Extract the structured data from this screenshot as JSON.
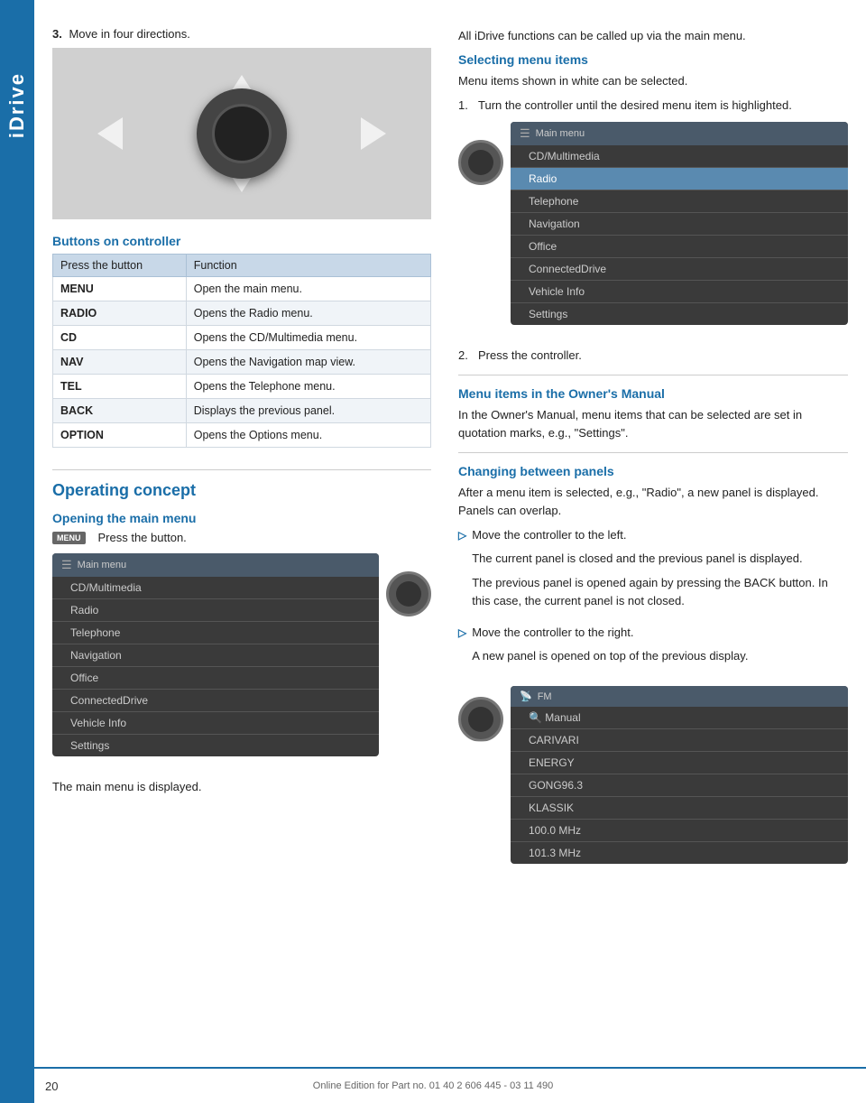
{
  "sidebar": {
    "label": "iDrive"
  },
  "page": {
    "number": "20",
    "footer_text": "Online Edition for Part no. 01 40 2 606 445 - 03 11 490"
  },
  "left_column": {
    "step3_text": "Move in four directions.",
    "buttons_section_heading": "Buttons on controller",
    "table": {
      "col1": "Press the button",
      "col2": "Function",
      "rows": [
        {
          "button": "MENU",
          "function": "Open the main menu."
        },
        {
          "button": "RADIO",
          "function": "Opens the Radio menu."
        },
        {
          "button": "CD",
          "function": "Opens the CD/Multimedia menu."
        },
        {
          "button": "NAV",
          "function": "Opens the Navigation map view."
        },
        {
          "button": "TEL",
          "function": "Opens the Telephone menu."
        },
        {
          "button": "BACK",
          "function": "Displays the previous panel."
        },
        {
          "button": "OPTION",
          "function": "Opens the Options menu."
        }
      ]
    },
    "operating_concept_heading": "Operating concept",
    "opening_main_menu_heading": "Opening the main menu",
    "menu_button_label": "MENU",
    "press_button_text": "Press the button.",
    "main_menu_title": "Main menu",
    "main_menu_items": [
      {
        "label": "CD/Multimedia",
        "active": false
      },
      {
        "label": "Radio",
        "active": false
      },
      {
        "label": "Telephone",
        "active": false
      },
      {
        "label": "Navigation",
        "active": false
      },
      {
        "label": "Office",
        "active": false
      },
      {
        "label": "ConnectedDrive",
        "active": false
      },
      {
        "label": "Vehicle Info",
        "active": false
      },
      {
        "label": "Settings",
        "active": false
      }
    ],
    "main_menu_displayed_text": "The main menu is displayed."
  },
  "right_column": {
    "intro_text": "All iDrive functions can be called up via the main menu.",
    "selecting_menu_items_heading": "Selecting menu items",
    "selecting_menu_items_intro": "Menu items shown in white can be selected.",
    "step1_text": "Turn the controller until the desired menu item is highlighted.",
    "main_menu_title": "Main menu",
    "main_menu_items": [
      {
        "label": "CD/Multimedia",
        "active": false
      },
      {
        "label": "Radio",
        "active": true
      },
      {
        "label": "Telephone",
        "active": false
      },
      {
        "label": "Navigation",
        "active": false
      },
      {
        "label": "Office",
        "active": false
      },
      {
        "label": "ConnectedDrive",
        "active": false
      },
      {
        "label": "Vehicle Info",
        "active": false
      },
      {
        "label": "Settings",
        "active": false
      }
    ],
    "step2_text": "Press the controller.",
    "menu_items_owners_manual_heading": "Menu items in the Owner's Manual",
    "menu_items_owners_manual_text": "In the Owner's Manual, menu items that can be selected are set in quotation marks, e.g., \"Settings\".",
    "changing_panels_heading": "Changing between panels",
    "changing_panels_intro": "After a menu item is selected, e.g., \"Radio\", a new panel is displayed. Panels can overlap.",
    "bullet1_text": "Move the controller to the left.",
    "bullet1_sub1": "The current panel is closed and the previous panel is displayed.",
    "bullet1_sub2": "The previous panel is opened again by pressing the BACK button. In this case, the current panel is not closed.",
    "bullet2_text": "Move the controller to the right.",
    "bullet2_sub1": "A new panel is opened on top of the previous display.",
    "fm_title": "FM",
    "fm_items": [
      {
        "label": "Manual",
        "active": false,
        "icon": true
      },
      {
        "label": "CARIVARI",
        "active": false
      },
      {
        "label": "ENERGY",
        "active": false
      },
      {
        "label": "GONG96.3",
        "active": false
      },
      {
        "label": "KLASSIK",
        "active": false
      },
      {
        "label": "100.0  MHz",
        "active": false
      },
      {
        "label": "101.3  MHz",
        "active": false
      }
    ]
  }
}
